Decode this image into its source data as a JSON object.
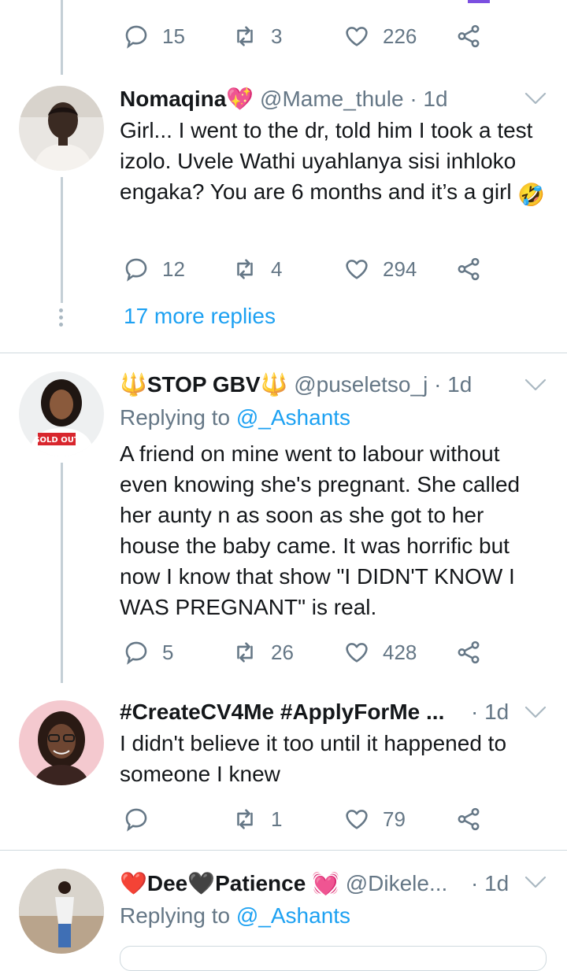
{
  "accent_color": "#1da1f2",
  "muted_color": "#657786",
  "tweets": [
    {
      "actions": {
        "replies": "15",
        "retweets": "3",
        "likes": "226"
      }
    },
    {
      "name": "Nomaqina",
      "name_emoji": "💖",
      "handle": "@Mame_thule",
      "time": "· 1d",
      "text": "Girl... I went to the dr, told him I took a test izolo. Uvele Wathi uyahlanya sisi inhloko engaka? You are 6 months and it’s a girl",
      "text_emoji": "🤣",
      "actions": {
        "replies": "12",
        "retweets": "4",
        "likes": "294"
      },
      "more_replies": "17 more replies"
    },
    {
      "name_prefix_emoji": "🔱",
      "name": "STOP GBV",
      "name_suffix_emoji": "🔱",
      "handle": "@puseletso_j",
      "time": "· 1d",
      "replying_label": "Replying to",
      "replying_to": "@_Ashants",
      "text": "A friend on mine went to labour without even knowing she's pregnant. She called her aunty n as soon as she got to her house the baby came. It was horrific but now I know that show \"I DIDN'T KNOW I WAS PREGNANT\" is real.",
      "avatar_shirt_text": "SOLD OUT",
      "actions": {
        "replies": "5",
        "retweets": "26",
        "likes": "428"
      }
    },
    {
      "name": "#CreateCV4Me #ApplyForMe ...",
      "time": "· 1d",
      "text": "I didn't believe it too until it happened to someone I knew",
      "actions": {
        "replies": "",
        "retweets": "1",
        "likes": "79"
      }
    },
    {
      "name_emoji_1": "❤️",
      "name_part1": "Dee",
      "name_emoji_2": "🖤",
      "name_part2": "Patience",
      "name_emoji_3": "💓",
      "handle": "@Dikele...",
      "time": "· 1d",
      "replying_label": "Replying to",
      "replying_to": "@_Ashants"
    }
  ],
  "icons": [
    "reply-icon",
    "retweet-icon",
    "like-icon",
    "share-icon",
    "chevron-down-icon"
  ]
}
